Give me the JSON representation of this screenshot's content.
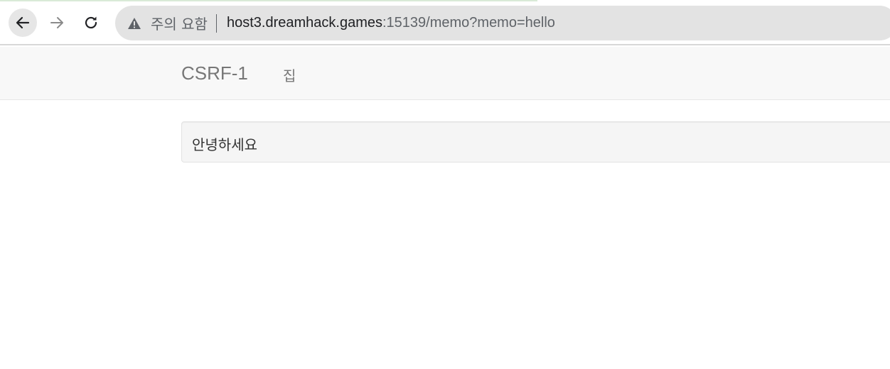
{
  "browser": {
    "security_label": "주의 요함",
    "url_host": "host3.dreamhack.games",
    "url_path": ":15139/memo?memo=hello",
    "icons": {
      "back": "arrow-left-icon",
      "forward": "arrow-right-icon",
      "reload": "reload-icon",
      "security": "warning-icon"
    }
  },
  "navbar": {
    "brand": "CSRF-1",
    "home_link": "집"
  },
  "main": {
    "memo_text": "안녕하세요"
  }
}
